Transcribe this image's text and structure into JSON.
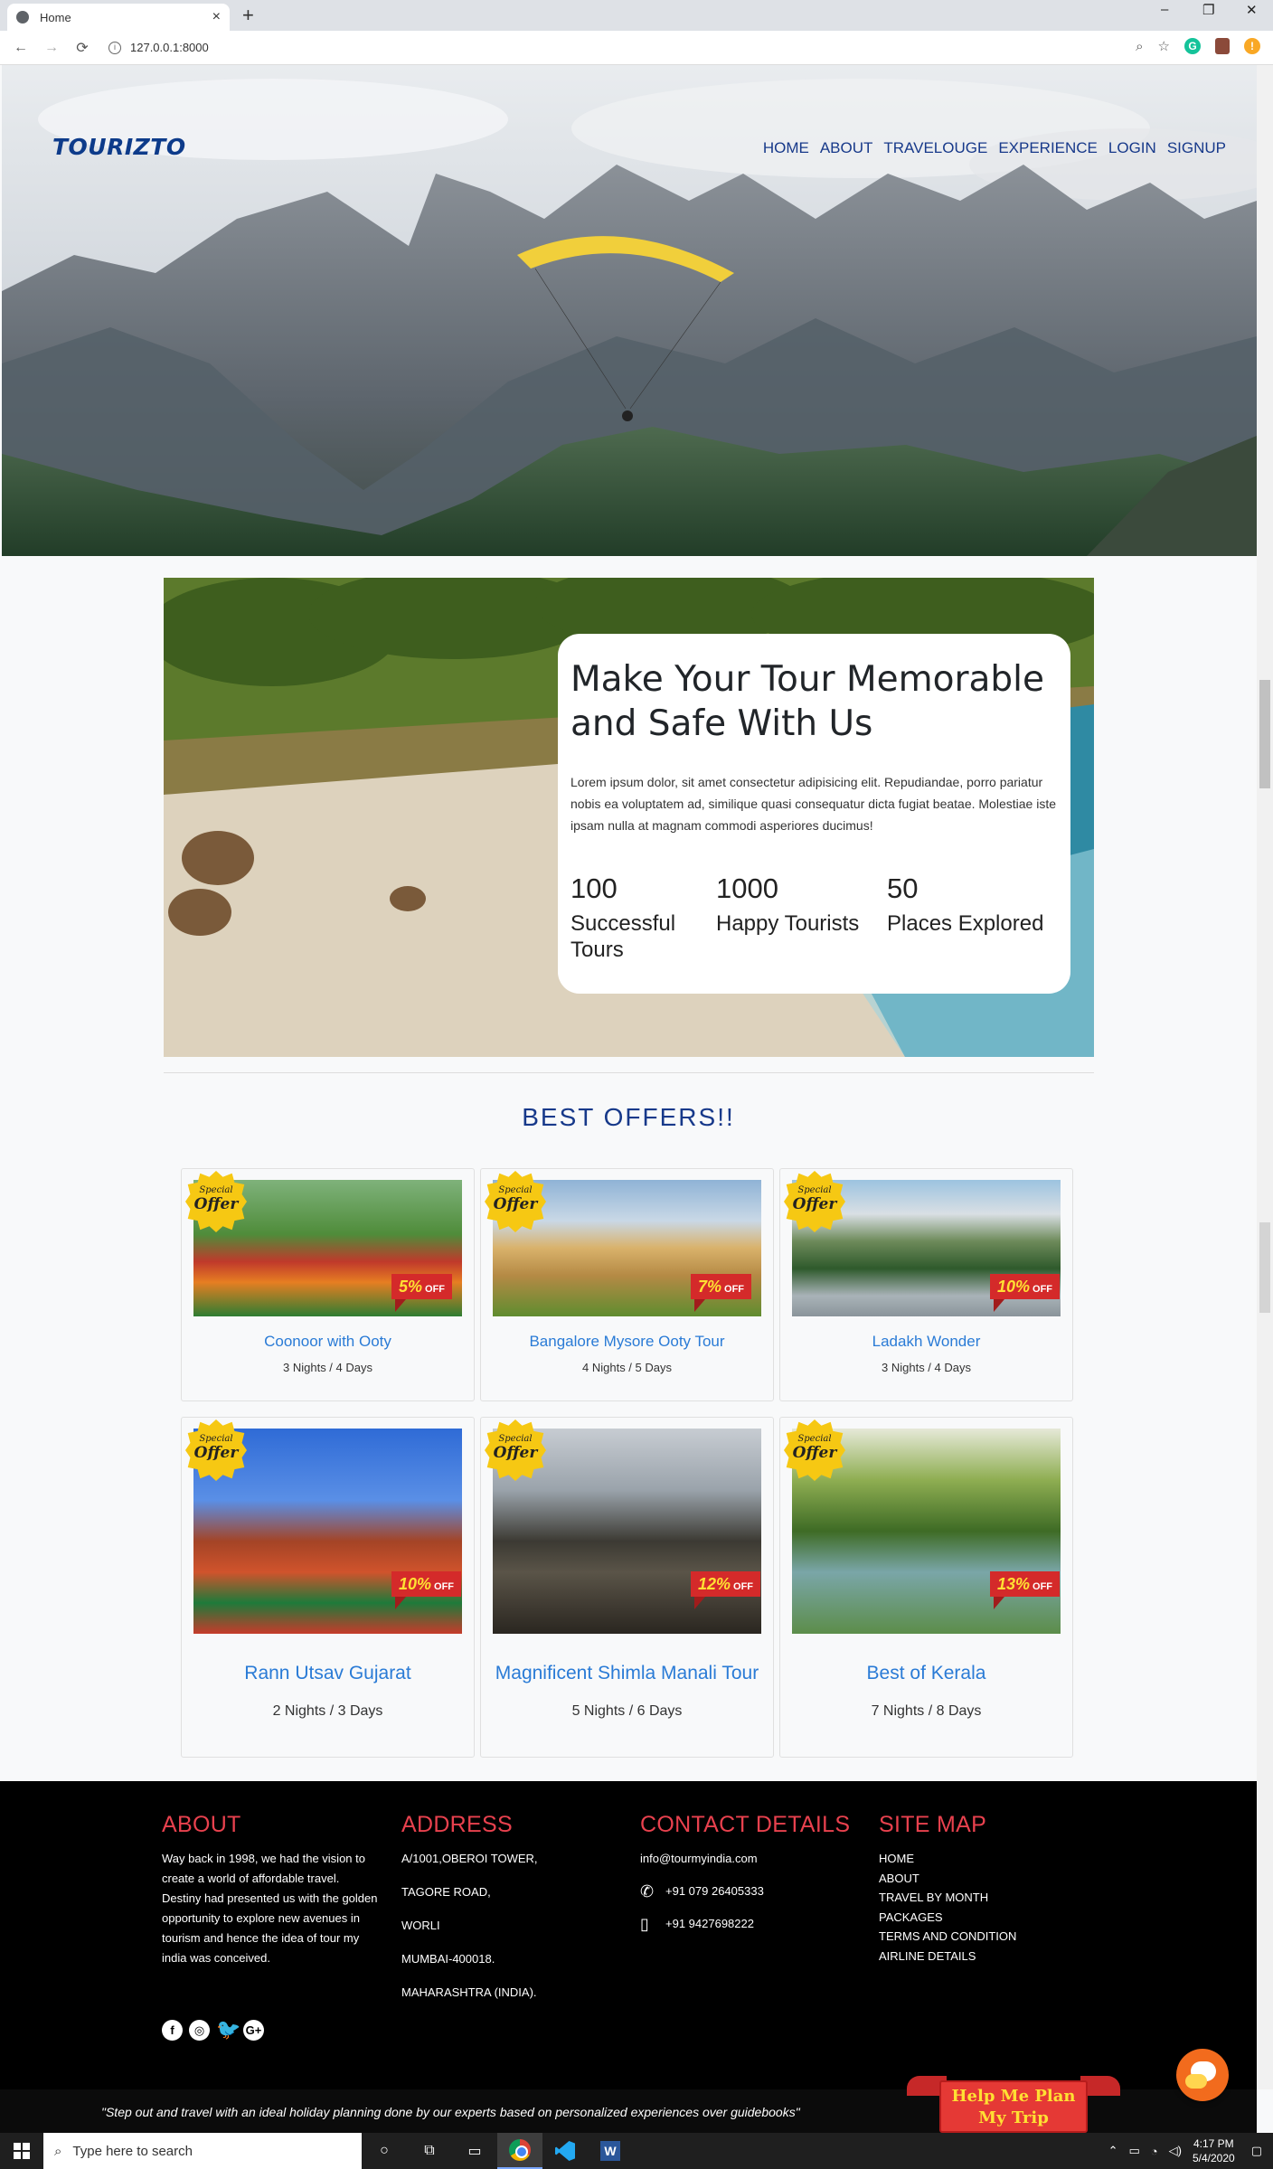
{
  "browser": {
    "tab_title": "Home",
    "url": "127.0.0.1:8000",
    "new_tab": "+",
    "tab_close": "×",
    "win_min": "–",
    "win_restore": "❐",
    "win_close": "✕"
  },
  "site": {
    "logo": "TOURIZTO",
    "nav": [
      "HOME",
      "ABOUT",
      "TRAVELOUGE",
      "EXPERIENCE",
      "LOGIN",
      "SIGNUP"
    ]
  },
  "about": {
    "heading": "Make Your Tour Memorable and Safe With Us",
    "body": "Lorem ipsum dolor, sit amet consectetur adipisicing elit. Repudiandae, porro pariatur nobis ea voluptatem ad, similique quasi consequatur dicta fugiat beatae. Molestiae iste ipsam nulla at magnam commodi asperiores ducimus!",
    "stats": [
      {
        "value": "100",
        "label": "Successful Tours"
      },
      {
        "value": "1000",
        "label": "Happy Tourists"
      },
      {
        "value": "50",
        "label": "Places Explored"
      }
    ]
  },
  "offers": {
    "title": "BEST OFFERS!!",
    "badge_small": "Special",
    "badge_big": "Offer",
    "off_label": "OFF",
    "items": [
      {
        "name": "Coonoor with Ooty",
        "duration": "3 Nights / 4 Days",
        "discount": "5%"
      },
      {
        "name": "Bangalore Mysore Ooty Tour",
        "duration": "4 Nights / 5 Days",
        "discount": "7%"
      },
      {
        "name": "Ladakh Wonder",
        "duration": "3 Nights / 4 Days",
        "discount": "10%"
      },
      {
        "name": "Rann Utsav Gujarat",
        "duration": "2 Nights / 3 Days",
        "discount": "10%"
      },
      {
        "name": "Magnificent Shimla Manali Tour",
        "duration": "5 Nights / 6 Days",
        "discount": "12%"
      },
      {
        "name": "Best of Kerala",
        "duration": "7 Nights / 8 Days",
        "discount": "13%"
      }
    ]
  },
  "footer": {
    "about_title": "ABOUT",
    "about_text": "Way back in 1998, we had the vision to create a world of affordable travel. Destiny had presented us with the golden opportunity to explore new avenues in tourism and hence the idea of tour my india was conceived.",
    "address_title": "ADDRESS",
    "address_lines": [
      "A/1001,OBEROI TOWER,",
      "TAGORE ROAD,",
      "WORLI",
      "MUMBAI-400018.",
      "MAHARASHTRA (INDIA)."
    ],
    "contact_title": "CONTACT DETAILS",
    "email": "info@tourmyindia.com",
    "phone": "+91 079 26405333",
    "mobile": "+91 9427698222",
    "sitemap_title": "SITE MAP",
    "sitemap_links": [
      "HOME",
      "ABOUT",
      "TRAVEL BY MONTH",
      "PACKAGES",
      "TERMS AND CONDITION",
      "AIRLINE DETAILS"
    ],
    "social_icons": [
      "facebook-icon",
      "instagram-icon",
      "twitter-icon",
      "google-plus-icon"
    ],
    "quote": "\"Step out and travel with an ideal holiday planning done by our experts based on personalized experiences over guidebooks\"",
    "plan_button": "Help Me Plan My Trip"
  },
  "taskbar": {
    "search_placeholder": "Type here to search",
    "time": "4:17 PM",
    "date": "5/4/2020"
  },
  "colors": {
    "nav": "#17398a",
    "offer_link": "#2a7bd6",
    "footer_heading": "#e8414e",
    "ribbon": "#d42a2a",
    "badge": "#f6c813"
  }
}
